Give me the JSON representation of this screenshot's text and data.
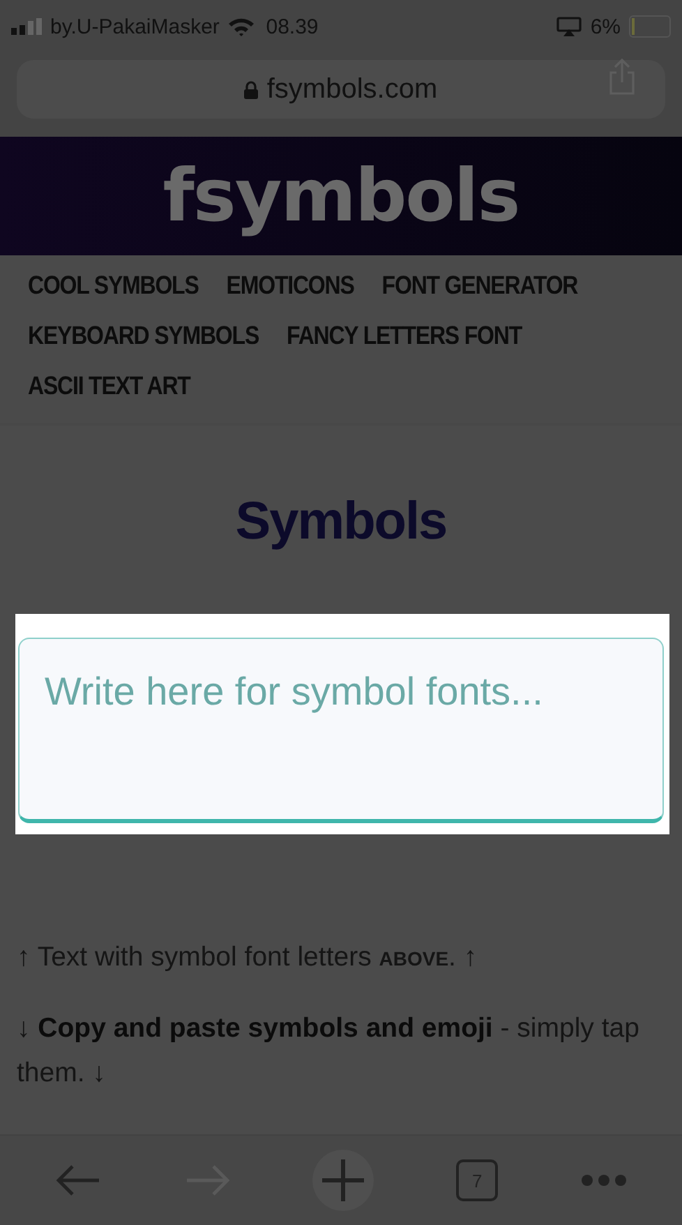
{
  "status_bar": {
    "carrier": "by.U-PakaiMasker",
    "time": "08.39",
    "battery": "6%"
  },
  "address_bar": {
    "url": "fsymbols.com"
  },
  "site_logo": "fsymbols",
  "nav_links": [
    {
      "label": "COOL SYMBOLS"
    },
    {
      "label": "EMOTICONS"
    },
    {
      "label": "FONT GENERATOR"
    },
    {
      "label": "KEYBOARD SYMBOLS"
    },
    {
      "label": "FANCY LETTERS FONT"
    },
    {
      "label": "ASCII TEXT ART"
    }
  ],
  "heading": "Symbols",
  "input": {
    "placeholder": "Write here for symbol fonts..."
  },
  "notes": [
    {
      "parts": [
        {
          "text": "↑ Text with symbol font letters ",
          "kind": "plain"
        },
        {
          "text": "ABOVE",
          "kind": "smallcaps"
        },
        {
          "text": ". ↑",
          "kind": "plain"
        }
      ]
    },
    {
      "parts": [
        {
          "text": "↓ ",
          "kind": "plain"
        },
        {
          "text": "Copy and paste symbols and emoji",
          "kind": "bold"
        },
        {
          "text": " - simply tap them. ↓",
          "kind": "plain"
        }
      ]
    }
  ],
  "toolbar": {
    "back_disabled": false,
    "forward_disabled": true,
    "tab_count": "7"
  }
}
